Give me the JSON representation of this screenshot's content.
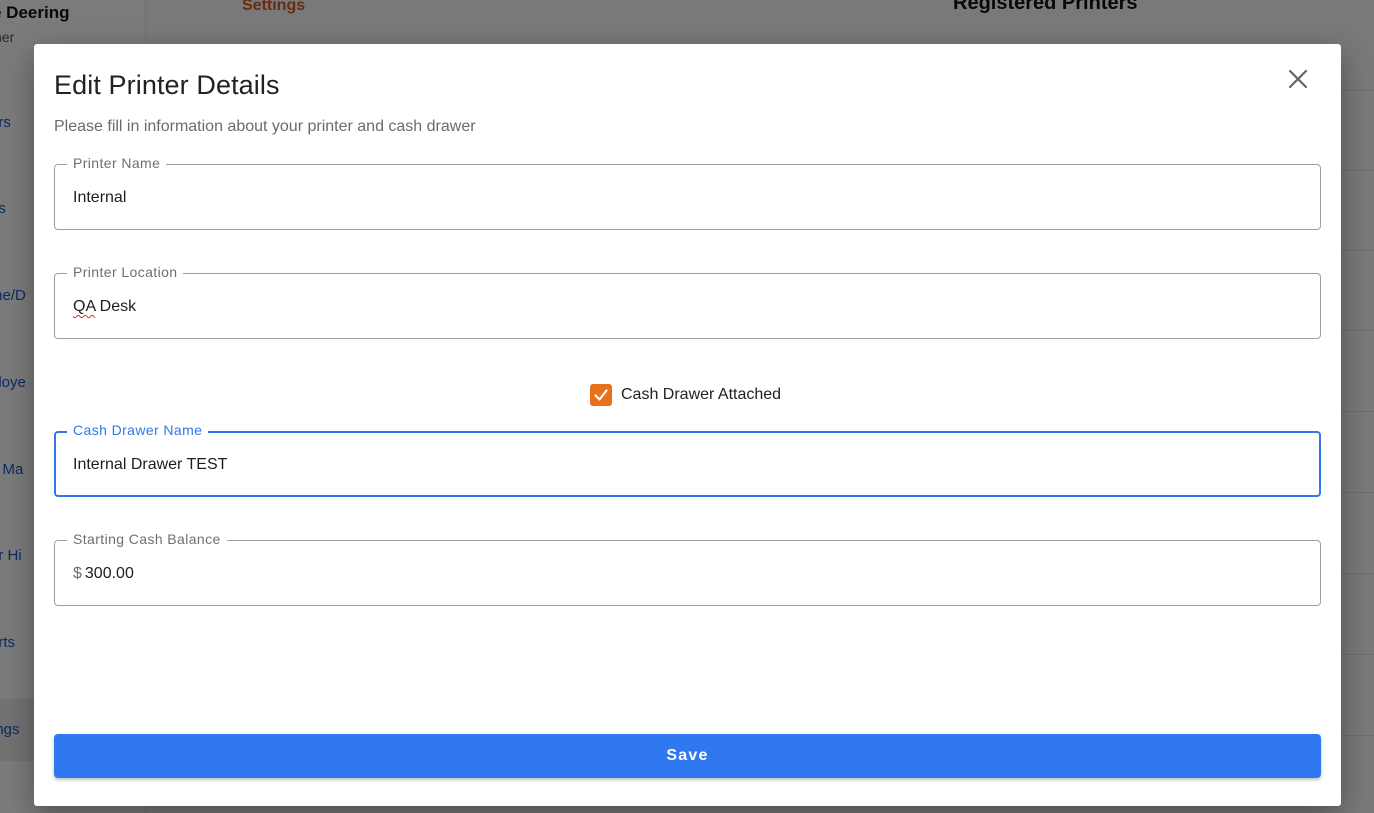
{
  "background": {
    "sidebar": {
      "user_name": "e Deering",
      "user_role": "ner",
      "items": [
        {
          "label": "ers"
        },
        {
          "label": "es"
        },
        {
          "label": "me/D"
        },
        {
          "label": "ploye"
        },
        {
          "label": "n Ma"
        },
        {
          "label": "er Hi"
        },
        {
          "label": "orts"
        },
        {
          "label": "ings"
        }
      ]
    },
    "header": {
      "tab_label": "Settings",
      "section_title": "Registered Printers"
    }
  },
  "modal": {
    "title": "Edit Printer Details",
    "subtitle": "Please fill in information about your printer and cash drawer",
    "close_icon": "close-icon",
    "fields": {
      "printer_name": {
        "label": "Printer Name",
        "value": "Internal"
      },
      "printer_location": {
        "label": "Printer Location",
        "value_underlined": "QA",
        "value_rest": " Desk"
      },
      "cash_drawer_name": {
        "label": "Cash Drawer Name",
        "value": "Internal Drawer TEST"
      },
      "starting_cash_balance": {
        "label": "Starting Cash Balance",
        "prefix": "$",
        "value": "300.00"
      }
    },
    "cash_drawer_checkbox": {
      "label": "Cash Drawer Attached",
      "checked": true,
      "icon": "checkmark-icon"
    },
    "save_label": "Save"
  },
  "colors": {
    "accent": "#2f78f0",
    "focus": "#2f78e6",
    "checkbox": "#e8711c",
    "settings_tab": "#d0571c"
  }
}
